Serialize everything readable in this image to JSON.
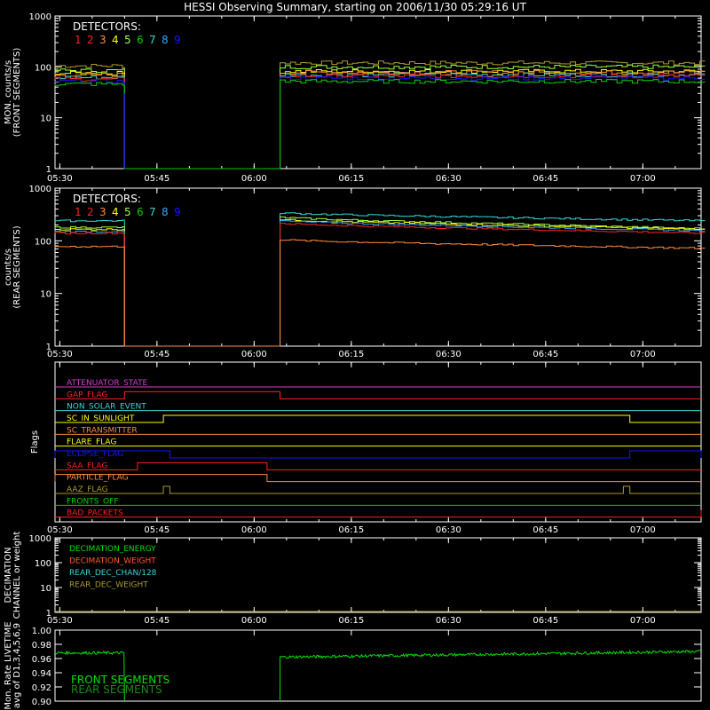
{
  "title": "HESSI Observing Summary, starting on 2006/11/30 05:29:16 UT",
  "colors": {
    "background": "#000000",
    "axes": "#ffffff",
    "detectors": [
      "#ff2020",
      "#ff2020",
      "#ff8a3d",
      "#ffff00",
      "#9bff40",
      "#00d000",
      "#36d7d7",
      "#2aa8ff",
      "#1515ff"
    ]
  },
  "chart_data": [
    {
      "type": "line",
      "panel": "front",
      "ylabel": [
        "MON. counts/s",
        "(FRONT SEGMENTS)"
      ],
      "legend_title": "DETECTORS:",
      "legend_items": [
        "1",
        "2",
        "3",
        "4",
        "5",
        "6",
        "7",
        "8",
        "9"
      ],
      "x_ticks": [
        "05:30",
        "05:45",
        "06:00",
        "06:15",
        "06:30",
        "06:45",
        "07:00"
      ],
      "y_scale": "log",
      "y_ticks": [
        "1",
        "10",
        "100",
        "1000"
      ],
      "ylim": [
        1,
        1000
      ],
      "xlim": [
        "05:29",
        "07:09"
      ],
      "gap": [
        "05:40",
        "06:04"
      ],
      "series": [
        {
          "color": "#aa9a2a",
          "values_before": 105,
          "values_after": 120
        },
        {
          "color": "#9bff40",
          "values_before": 85,
          "values_after": 100
        },
        {
          "color": "#ffff00",
          "values_before": 75,
          "values_after": 82
        },
        {
          "color": "#ff8a3d",
          "values_before": 70,
          "values_after": 78
        },
        {
          "color": "#36d7d7",
          "values_before": 62,
          "values_after": 70
        },
        {
          "color": "#ff2020",
          "values_before": 57,
          "values_after": 66
        },
        {
          "color": "#1515ff",
          "values_before": 52,
          "values_after": 60
        },
        {
          "color": "#00d000",
          "values_before": 46,
          "values_after": 52
        }
      ]
    },
    {
      "type": "line",
      "panel": "rear",
      "ylabel": [
        "counts/s",
        "(REAR SEGMENTS)"
      ],
      "legend_title": "DETECTORS:",
      "legend_items": [
        "1",
        "2",
        "3",
        "4",
        "5",
        "6",
        "7",
        "8",
        "9"
      ],
      "x_ticks": [
        "05:30",
        "05:45",
        "06:00",
        "06:15",
        "06:30",
        "06:45",
        "07:00"
      ],
      "y_scale": "log",
      "y_ticks": [
        "1",
        "10",
        "100",
        "1000"
      ],
      "ylim": [
        1,
        1000
      ],
      "xlim": [
        "05:29",
        "07:09"
      ],
      "gap": [
        "05:40",
        "06:04"
      ],
      "series": [
        {
          "color": "#36d7d7",
          "values_before": 240,
          "values_after_start": 340,
          "values_after_end": 240
        },
        {
          "color": "#9bff40",
          "values_before": 180,
          "values_after_start": 280,
          "values_after_end": 170
        },
        {
          "color": "#ffff00",
          "values_before": 165,
          "values_after_start": 255,
          "values_after_end": 165
        },
        {
          "color": "#2aa8ff",
          "values_before": 150,
          "values_after_start": 240,
          "values_after_end": 155
        },
        {
          "color": "#ff2020",
          "values_before": 140,
          "values_after_start": 215,
          "values_after_end": 140
        },
        {
          "color": "#ff8a3d",
          "values_before": 78,
          "values_after_start": 105,
          "values_after_end": 72
        }
      ]
    },
    {
      "type": "line",
      "panel": "flags",
      "ylabel": "Flags",
      "x_ticks": [
        "05:30",
        "05:45",
        "06:00",
        "06:15",
        "06:30",
        "06:45",
        "07:00"
      ],
      "xlim": [
        "05:29",
        "07:09"
      ],
      "flags": [
        {
          "label": "ATTENUATOR_STATE",
          "color": "#d040d0",
          "on": []
        },
        {
          "label": "GAP_FLAG",
          "color": "#ff2020",
          "on": [
            [
              "05:40",
              "06:04"
            ]
          ]
        },
        {
          "label": "NON_SOLAR_EVENT",
          "color": "#36d7d7",
          "on": []
        },
        {
          "label": "SC_IN_SUNLIGHT",
          "color": "#ffff00",
          "on": [
            [
              "05:46",
              "06:58"
            ]
          ]
        },
        {
          "label": "SC_TRANSMITTER",
          "color": "#ff8a3d",
          "on": []
        },
        {
          "label": "FLARE_FLAG",
          "color": "#ffff00",
          "on": []
        },
        {
          "label": "ECLIPSE_FLAG",
          "color": "#1515ff",
          "on": [
            [
              "05:29",
              "05:47"
            ],
            [
              "06:58",
              "07:09"
            ]
          ]
        },
        {
          "label": "SAA_FLAG",
          "color": "#ff2020",
          "on": [
            [
              "05:42",
              "06:02"
            ]
          ]
        },
        {
          "label": "PARTICLE_FLAG",
          "color": "#ff8a3d",
          "on": [
            [
              "05:29",
              "06:02"
            ]
          ]
        },
        {
          "label": "AAZ_FLAG",
          "color": "#aa9a2a",
          "on": [
            [
              "05:46",
              "05:47"
            ],
            [
              "06:57",
              "06:58"
            ]
          ]
        },
        {
          "label": "FRONTS_OFF",
          "color": "#00d000",
          "on": []
        },
        {
          "label": "BAD_PACKETS",
          "color": "#ff2020",
          "on": [
            [
              "07:09",
              "07:09"
            ]
          ]
        }
      ]
    },
    {
      "type": "line",
      "panel": "decimation",
      "ylabel": [
        "DECIMATION",
        "CHANNEL or weight"
      ],
      "x_ticks": [
        "05:30",
        "05:45",
        "06:00",
        "06:15",
        "06:30",
        "06:45",
        "07:00"
      ],
      "y_scale": "log",
      "y_ticks": [
        "1",
        "10",
        "100",
        "1000"
      ],
      "ylim": [
        1,
        1000
      ],
      "legend": [
        {
          "label": "DECIMATION_ENERGY",
          "color": "#00e000"
        },
        {
          "label": "DECIMATION_WEIGHT",
          "color": "#ff5a2a"
        },
        {
          "label": "REAR_DEC_CHAN/128",
          "color": "#36d7d7"
        },
        {
          "label": "REAR_DEC_WEIGHT",
          "color": "#aa9a2a"
        }
      ]
    },
    {
      "type": "line",
      "panel": "livetime",
      "ylabel": [
        "Mon. Rate LIVETIME",
        "avg of D1,3,4,5,6,9"
      ],
      "y_ticks": [
        "0.90",
        "0.92",
        "0.94",
        "0.96",
        "0.98",
        "1.00"
      ],
      "ylim": [
        0.9,
        1.0
      ],
      "xlim": [
        "05:29",
        "07:09"
      ],
      "gap": [
        "05:40",
        "06:04"
      ],
      "legend": [
        {
          "label": "FRONT SEGMENTS",
          "color": "#00e000"
        },
        {
          "label": "REAR SEGMENTS",
          "color": "#1a8a1a"
        }
      ],
      "series": [
        {
          "name": "FRONT SEGMENTS",
          "color": "#00e000",
          "values_before": 0.968,
          "values_after_start": 0.962,
          "values_after_end": 0.97
        }
      ]
    }
  ]
}
